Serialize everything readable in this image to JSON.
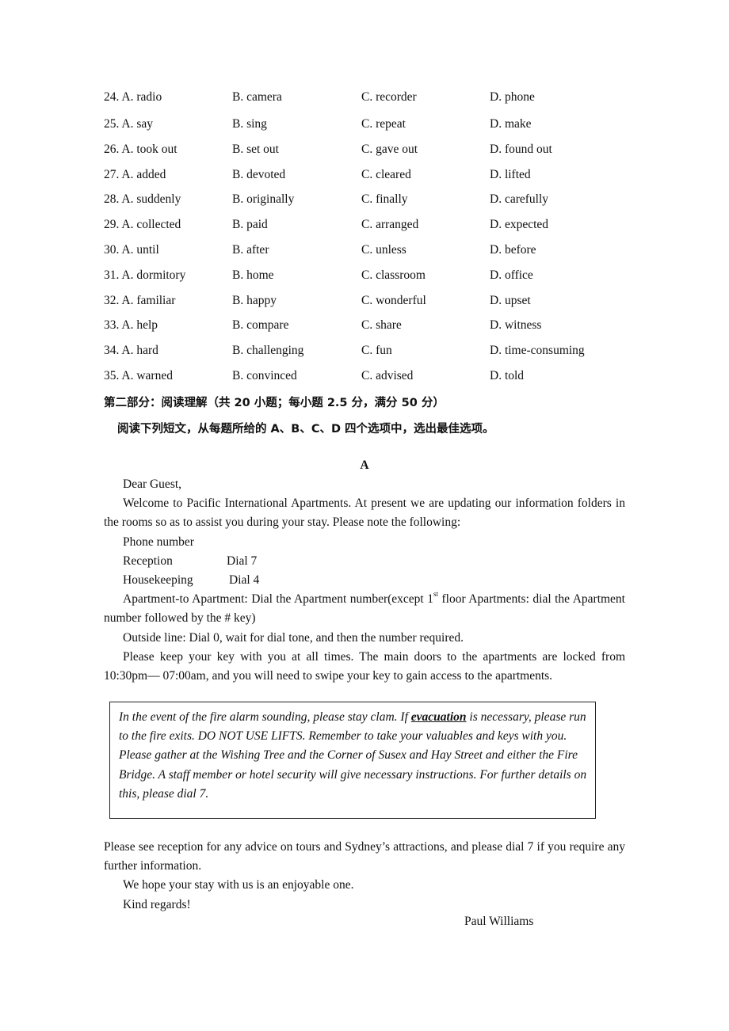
{
  "cloze_options": [
    {
      "num": "24.",
      "a": "A. radio",
      "b": "B. camera",
      "c": "C. recorder",
      "d": "D. phone"
    },
    {
      "num": "25.",
      "a": "A. say",
      "b": "B. sing",
      "c": "C. repeat",
      "d": "D. make"
    },
    {
      "num": "26.",
      "a": "A. took out",
      "b": "B. set out",
      "c": "C. gave out",
      "d": "D. found out"
    },
    {
      "num": "27.",
      "a": "A. added",
      "b": "B. devoted",
      "c": "C. cleared",
      "d": "D. lifted"
    },
    {
      "num": "28.",
      "a": "A. suddenly",
      "b": "B. originally",
      "c": "C. finally",
      "d": "D. carefully"
    },
    {
      "num": "29.",
      "a": "A. collected",
      "b": "B. paid",
      "c": "C. arranged",
      "d": "D. expected"
    },
    {
      "num": "30.",
      "a": "A. until",
      "b": "B. after",
      "c": "C. unless",
      "d": "D. before"
    },
    {
      "num": "31.",
      "a": "A. dormitory",
      "b": "B. home",
      "c": "C. classroom",
      "d": "D. office"
    },
    {
      "num": "32.",
      "a": "A. familiar",
      "b": "B. happy",
      "c": "C. wonderful",
      "d": "D. upset"
    },
    {
      "num": "33.",
      "a": "A. help",
      "b": "B. compare",
      "c": "C. share",
      "d": "D. witness"
    },
    {
      "num": "34.",
      "a": "A. hard",
      "b": "B. challenging",
      "c": "C. fun",
      "d": "D. time-consuming"
    },
    {
      "num": "35.",
      "a": "A. warned",
      "b": "B. convinced",
      "c": "C. advised",
      "d": "D. told"
    }
  ],
  "section": {
    "title": "第二部分：阅读理解（共 20 小题；每小题 2.5 分，满分 50 分）",
    "instructions": "阅读下列短文，从每题所给的 A、B、C、D 四个选项中，选出最佳选项。"
  },
  "passage": {
    "letter": "A",
    "greeting": "Dear Guest,",
    "intro": "Welcome to Pacific International Apartments. At present we are updating our information folders in the rooms so as to assist you during your stay. Please note the following:",
    "phone_heading": "Phone number",
    "phone_list": [
      {
        "label": "Reception",
        "value": "Dial 7"
      },
      {
        "label": "Housekeeping",
        "value": "Dial 4"
      }
    ],
    "apartment_line_pre": "Apartment-to Apartment: Dial the Apartment number(except 1",
    "apartment_line_sup": "st",
    "apartment_line_post": " floor Apartments: dial the Apartment number followed by the # key)",
    "outside_line": "Outside line: Dial 0, wait for dial tone, and then the number required.",
    "key_notice": "Please keep your key with you at all times. The main doors to the apartments are locked from 10:30pm—  07:00am, and you will need to swipe your key to gain access to the apartments.",
    "fire_notice_pre": "In the event of the fire alarm sounding, please stay clam. If ",
    "fire_notice_keyword": "evacuation",
    "fire_notice_post": " is necessary, please run to the fire exits. DO NOT USE LIFTS. Remember to take your valuables and keys with you. Please gather at the Wishing Tree and the Corner of Susex and Hay Street and either the Fire Bridge. A staff member or hotel security will give necessary instructions. For further details on this, please dial 7.",
    "reception_advice": "Please see reception for any advice on tours and Sydney’s attractions, and please dial 7 if you require any further information.",
    "hope": "We hope your stay with us is an enjoyable one.",
    "regards": "Kind regards!",
    "signature": "Paul Williams"
  }
}
